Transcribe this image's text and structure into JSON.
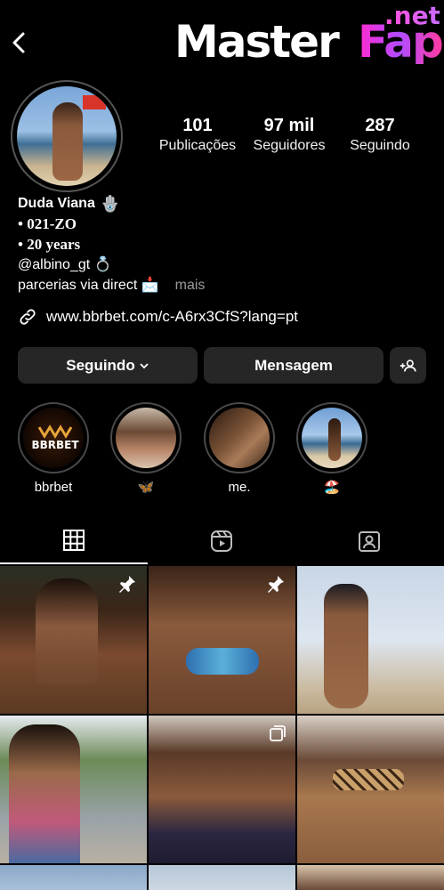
{
  "watermark": {
    "part1": "Master",
    "part2": "Fap",
    "part3": ".net"
  },
  "profile": {
    "name": "Duda Viana",
    "name_emoji": "🪬",
    "bio_lines": [
      "• 021-ZO",
      "• 20 years",
      "@albino_gt 💍",
      "parcerias via direct 📩"
    ],
    "more_label": "mais",
    "link": "www.bbrbet.com/c-A6rx3CfS?lang=pt"
  },
  "stats": [
    {
      "value": "101",
      "label": "Publicações"
    },
    {
      "value": "97 mil",
      "label": "Seguidores"
    },
    {
      "value": "287",
      "label": "Seguindo"
    }
  ],
  "buttons": {
    "following": "Seguindo",
    "message": "Mensagem"
  },
  "stories": [
    {
      "caption": "bbrbet",
      "logo_text": "BBRBET"
    },
    {
      "caption": "🦋"
    },
    {
      "caption": "me."
    },
    {
      "caption": "🏖️"
    }
  ],
  "tabs": [
    "grid-icon",
    "reels-icon",
    "tagged-icon"
  ],
  "colors": {
    "background": "#000000",
    "button": "#262626",
    "secondary_text": "#9a9a9a"
  }
}
